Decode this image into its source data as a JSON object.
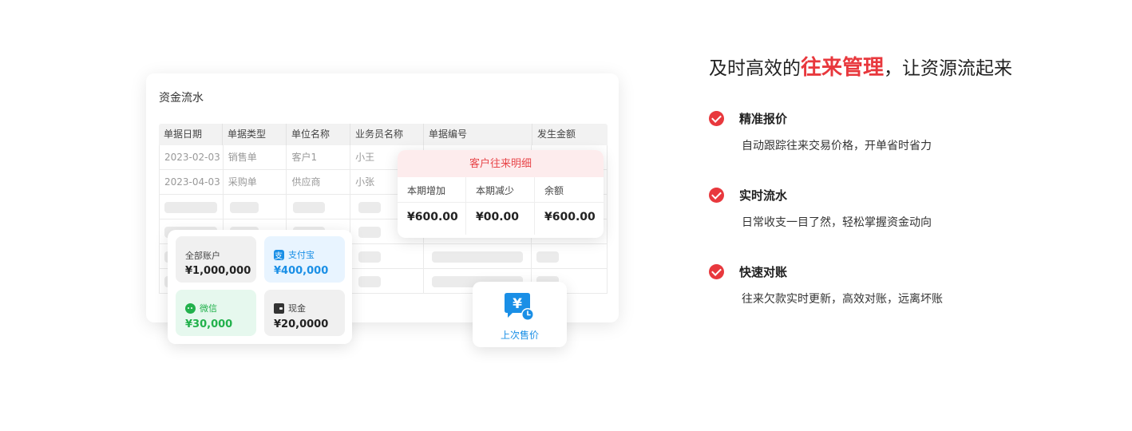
{
  "ledger": {
    "title": "资金流水",
    "columns": [
      "单据日期",
      "单据类型",
      "单位名称",
      "业务员名称",
      "单据编号",
      "发生金额"
    ],
    "rows": [
      [
        "2023-02-03",
        "销售单",
        "客户1",
        "小王",
        "",
        ""
      ],
      [
        "2023-04-03",
        "采购单",
        "供应商",
        "小张",
        "",
        ""
      ]
    ]
  },
  "popup": {
    "title": "客户往来明细",
    "columns": [
      "本期增加",
      "本期减少",
      "余额"
    ],
    "values": [
      "¥600.00",
      "¥00.00",
      "¥600.00"
    ]
  },
  "accounts": {
    "all": {
      "label": "全部账户",
      "value": "¥1,000,000"
    },
    "alipay": {
      "label": "支付宝",
      "value": "¥400,000",
      "icon": "alipay-icon"
    },
    "wechat": {
      "label": "微信",
      "value": "¥30,000",
      "icon": "wechat-icon"
    },
    "cash": {
      "label": "现金",
      "value": "¥20,0000",
      "icon": "wallet-icon"
    }
  },
  "last_price": {
    "label": "上次售价",
    "icon": "yen-clock-icon"
  },
  "headline": {
    "prefix": "及时高效的",
    "highlight": "往来管理",
    "suffix": "，让资源流起来"
  },
  "features": [
    {
      "title": "精准报价",
      "desc": "自动跟踪往来交易价格，开单省时省力"
    },
    {
      "title": "实时流水",
      "desc": "日常收支一目了然，轻松掌握资金动向"
    },
    {
      "title": "快速对账",
      "desc": "往来欠款实时更新，高效对账，远离坏账"
    }
  ],
  "colors": {
    "accent_red": "#e8383d",
    "alipay_blue": "#1a8fe6",
    "wechat_green": "#22b14c"
  }
}
